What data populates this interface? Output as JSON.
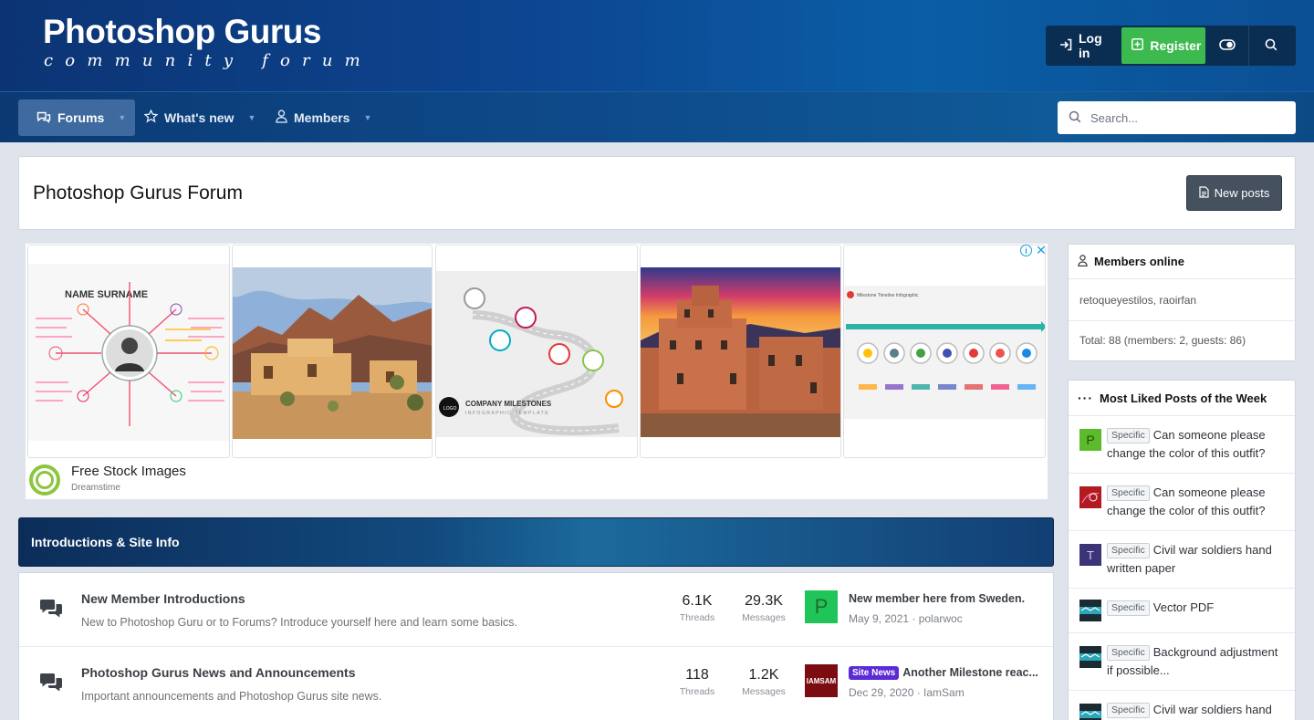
{
  "site": {
    "logo_main": "Photoshop Gurus",
    "logo_sub": "community forum"
  },
  "account": {
    "login_label": "Log in",
    "register_label": "Register",
    "theme_icon": "toggle-icon",
    "search_icon": "search-icon"
  },
  "nav": {
    "items": [
      {
        "label": "Forums",
        "icon": "chat-bubbles-icon"
      },
      {
        "label": "What's new",
        "icon": "star-icon"
      },
      {
        "label": "Members",
        "icon": "user-icon"
      }
    ],
    "search_placeholder": "Search..."
  },
  "page": {
    "title": "Photoshop Gurus Forum",
    "new_posts_label": "New posts"
  },
  "ad": {
    "brand": "Free Stock Images",
    "source": "Dreamstime",
    "tile1_title": "NAME SURNAME",
    "tile3_title": "COMPANY MILESTONES",
    "tile3_sub": "INFOGRAPHIC TEMPLATE",
    "tile3_logo": "LOGO",
    "tile5_title": "Milestone Timeline Infographic"
  },
  "category": {
    "title": "Introductions & Site Info",
    "forums": [
      {
        "title": "New Member Introductions",
        "description": "New to Photoshop Guru or to Forums? Introduce yourself here and learn some basics.",
        "threads": "6.1K",
        "threads_label": "Threads",
        "messages": "29.3K",
        "messages_label": "Messages",
        "latest_avatar_letter": "P",
        "latest_title": "New member here from Sweden.",
        "latest_meta": "May 9, 2021 · polarwoc"
      },
      {
        "title": "Photoshop Gurus News and Announcements",
        "description": "Important announcements and Photoshop Gurus site news.",
        "threads": "118",
        "threads_label": "Threads",
        "messages": "1.2K",
        "messages_label": "Messages",
        "latest_avatar_letter": "IAMSAM",
        "latest_label": "Site News",
        "latest_title": "Another Milestone reac...",
        "latest_meta": "Dec 29, 2020 · IamSam"
      }
    ]
  },
  "sidebar": {
    "members_online": {
      "title": "Members online",
      "users": "retoqueyestilos, raoirfan",
      "total": "Total: 88 (members: 2, guests: 86)"
    },
    "most_liked": {
      "title": "Most Liked Posts of the Week",
      "items": [
        {
          "tag": "Specific",
          "text": "Can someone please change the color of this outfit?",
          "avatar": "P",
          "color": "#5cbb2a"
        },
        {
          "tag": "Specific",
          "text": "Can someone please change the color of this outfit?",
          "avatar": "",
          "color": "#b21a22"
        },
        {
          "tag": "Specific",
          "text": "Civil war soldiers hand written paper",
          "avatar": "T",
          "color": "#3b3577"
        },
        {
          "tag": "Specific",
          "text": "Vector PDF",
          "avatar": "",
          "color": "#2aa7b8"
        },
        {
          "tag": "Specific",
          "text": "Background adjustment if possible...",
          "avatar": "",
          "color": "#2aa7b8"
        },
        {
          "tag": "Specific",
          "text": "Civil war soldiers hand",
          "avatar": "",
          "color": "#2aa7b8"
        }
      ]
    }
  }
}
